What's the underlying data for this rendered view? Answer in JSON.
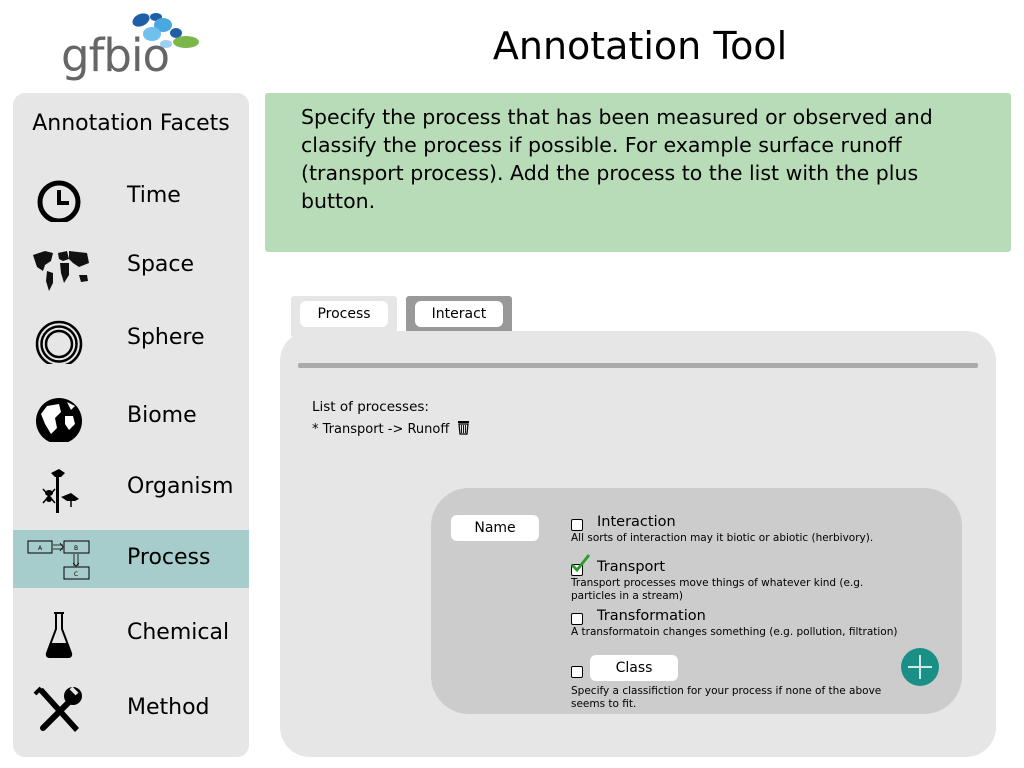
{
  "header": {
    "logo_text": "gfbio",
    "title": "Annotation Tool"
  },
  "sidebar": {
    "title": "Annotation Facets",
    "items": [
      {
        "label": "Time",
        "icon": "clock-icon",
        "active": false
      },
      {
        "label": "Space",
        "icon": "world-map-icon",
        "active": false
      },
      {
        "label": "Sphere",
        "icon": "concentric-circles-icon",
        "active": false
      },
      {
        "label": "Biome",
        "icon": "globe-icon",
        "active": false
      },
      {
        "label": "Organism",
        "icon": "organism-icon",
        "active": false
      },
      {
        "label": "Process",
        "icon": "process-diagram-icon",
        "active": true
      },
      {
        "label": "Chemical",
        "icon": "flask-icon",
        "active": false
      },
      {
        "label": "Method",
        "icon": "tools-icon",
        "active": false
      }
    ]
  },
  "instructions": {
    "text": "Specify the process that has been measured or observed and classify the process if possible. For example surface runoff (transport process). Add the process to the list with the plus button."
  },
  "tabs": [
    {
      "label": "Process",
      "active": true
    },
    {
      "label": "Interact",
      "active": false
    }
  ],
  "panel": {
    "list_label": "List of processes:",
    "list_items": [
      "* Transport -> Runoff"
    ],
    "name_field": "Name",
    "options": [
      {
        "label": "Interaction",
        "description": "All sorts of interaction may it biotic or abiotic (herbivory).",
        "checked": false
      },
      {
        "label": "Transport",
        "description": "Transport processes move things of whatever kind (e.g. particles in a stream)",
        "checked": true
      },
      {
        "label": "Transformation",
        "description": "A transformatoin changes something (e.g. pollution, filtration)",
        "checked": false
      }
    ],
    "class_option": {
      "label": "Class",
      "description": "Specify a classifiction for your process if none of the above seems to fit.",
      "checked": false
    }
  },
  "colors": {
    "sidebar_bg": "#e6e6e6",
    "sidebar_active": "#a7cccc",
    "instructions_bg": "#b8dcb8",
    "panel_bg": "#e6e6e6",
    "inner_bg": "#cccccc",
    "add_button": "#1a8f85",
    "check_mark": "#2a9a2a"
  }
}
